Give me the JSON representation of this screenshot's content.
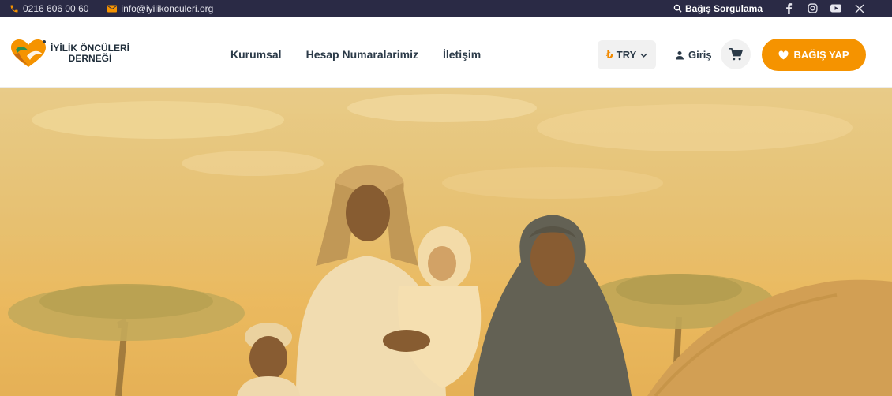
{
  "topbar": {
    "phone": "0216 606 00 60",
    "email": "info@iyilikonculeri.org",
    "donation_query": "Bağış Sorgulama",
    "social_icons": [
      "facebook-icon",
      "instagram-icon",
      "youtube-icon",
      "x-icon"
    ]
  },
  "header": {
    "logo_line1": "İYİLİK ÖNCÜLERİ",
    "logo_line2": "DERNEĞİ",
    "nav": [
      {
        "label": "Kurumsal"
      },
      {
        "label": "Hesap Numaralarimiz"
      },
      {
        "label": "İletişim"
      }
    ],
    "currency_symbol": "₺",
    "currency": "TRY",
    "login_label": "Giriş",
    "donate_label": "BAĞIŞ YAP"
  },
  "colors": {
    "topbar_bg": "#2a2a45",
    "accent": "#f59300",
    "text_dark": "#2b3a48"
  }
}
